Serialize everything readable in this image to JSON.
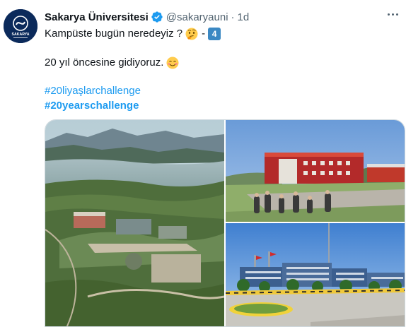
{
  "tweet": {
    "display_name": "Sakarya Üniversitesi",
    "handle": "@sakaryauni",
    "separator": "·",
    "time": "1d",
    "avatar_text": "SAKARYA",
    "line1_text": "Kampüste bugün neredeyiz ?",
    "line1_sep": "-",
    "keycap_text": "4",
    "line2_text": "20 yıl öncesine gidiyoruz.",
    "hashtag1": "#20liyaşlarchallenge",
    "hashtag2": "#20yearschallenge",
    "colors": {
      "link": "#1d9bf0",
      "secondary_text": "#536471",
      "verified_badge": "#1d9bf0",
      "keycap": "#3b88c3"
    },
    "icons": [
      "verified-badge-icon",
      "more-options-icon",
      "thinking-face-emoji",
      "keycap-4-emoji",
      "smiling-face-emoji"
    ]
  },
  "media": {
    "photos": [
      {
        "name": "aerial campus view by the lake"
      },
      {
        "name": "red-roofed campus buildings with students"
      },
      {
        "name": "campus buildings and roundabout"
      }
    ]
  }
}
